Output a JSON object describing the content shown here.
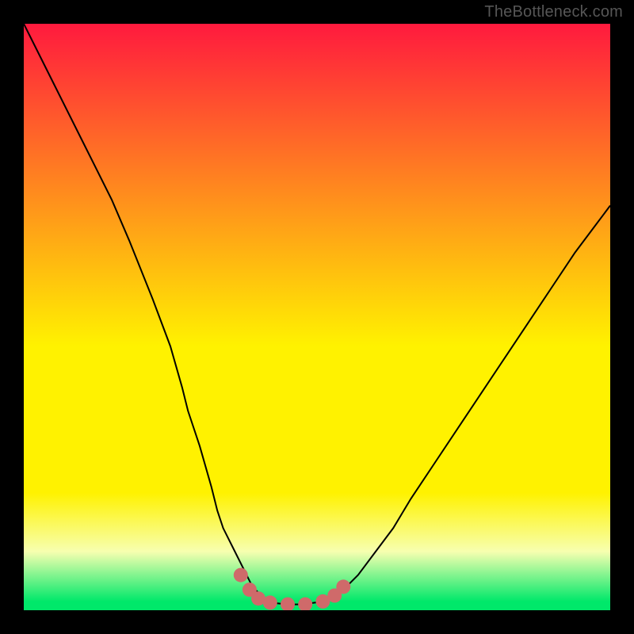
{
  "watermark": "TheBottleneck.com",
  "colors": {
    "black": "#000000",
    "curve": "#000000",
    "dots": "#cf6a6a",
    "gradient_top": "#ff1a3e",
    "gradient_mid": "#fff200",
    "gradient_low": "#f7ffb0",
    "gradient_green": "#00e86a"
  },
  "chart_data": {
    "type": "line",
    "title": "",
    "xlabel": "",
    "ylabel": "",
    "xlim": [
      0,
      100
    ],
    "ylim": [
      0,
      100
    ],
    "series": [
      {
        "name": "bottleneck-curve",
        "x": [
          0,
          5,
          10,
          12,
          15,
          18,
          20,
          22,
          25,
          27,
          28,
          30,
          32,
          33,
          34,
          36,
          38,
          39,
          40,
          41,
          42,
          43,
          45,
          47,
          49,
          51,
          54,
          57,
          60,
          63,
          66,
          70,
          74,
          78,
          82,
          86,
          90,
          94,
          97,
          100
        ],
        "values": [
          100,
          90,
          80,
          76,
          70,
          63,
          58,
          53,
          45,
          38,
          34,
          28,
          21,
          17,
          14,
          10,
          6,
          4,
          3,
          2,
          1.5,
          1.2,
          1,
          1,
          1.2,
          1.5,
          3,
          6,
          10,
          14,
          19,
          25,
          31,
          37,
          43,
          49,
          55,
          61,
          65,
          69
        ]
      }
    ],
    "dots": {
      "name": "highlight-dots",
      "points": [
        {
          "x": 37.0,
          "y": 6.0
        },
        {
          "x": 38.5,
          "y": 3.5
        },
        {
          "x": 40.0,
          "y": 2.0
        },
        {
          "x": 42.0,
          "y": 1.3
        },
        {
          "x": 45.0,
          "y": 1.0
        },
        {
          "x": 48.0,
          "y": 1.0
        },
        {
          "x": 51.0,
          "y": 1.5
        },
        {
          "x": 53.0,
          "y": 2.5
        },
        {
          "x": 54.5,
          "y": 4.0
        }
      ]
    },
    "gradient_stops": [
      {
        "offset": 0,
        "key": "gradient_top"
      },
      {
        "offset": 0.55,
        "key": "gradient_mid"
      },
      {
        "offset": 0.8,
        "key": "gradient_mid"
      },
      {
        "offset": 0.9,
        "key": "gradient_low"
      },
      {
        "offset": 0.985,
        "key": "gradient_green"
      },
      {
        "offset": 1.0,
        "key": "gradient_green"
      }
    ]
  }
}
